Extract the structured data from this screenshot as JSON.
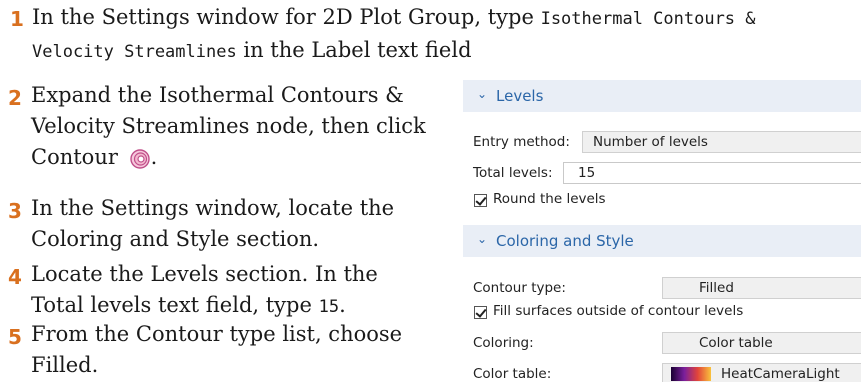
{
  "steps": [
    {
      "number": "1",
      "text_before": "In the Settings window for 2D Plot Group, type ",
      "code_1": "Isothermal Contours &",
      "code_2": "Velocity Streamlines",
      "text_after": " in the Label text field"
    },
    {
      "number": "2",
      "text_line1": "Expand the Isothermal Contours &",
      "text_line2": "Velocity Streamlines node, then click",
      "text_line3": "Contour",
      "icon": "contour-icon"
    },
    {
      "number": "3",
      "text_line1": "In the Settings window, locate the",
      "text_line2": "Coloring and Style section."
    },
    {
      "number": "4",
      "text_line1": "Locate the Levels section. In the",
      "text_line2_before": "Total levels text field, type ",
      "text_line2_code": "15",
      "text_line2_after": "."
    },
    {
      "number": "5",
      "text_line1": "From the Contour type list, choose",
      "text_line2": "Filled."
    }
  ],
  "settings": {
    "levels": {
      "title": "Levels",
      "entry_method_label": "Entry method:",
      "entry_method_value": "Number of levels",
      "total_levels_label": "Total levels:",
      "total_levels_value": "15",
      "round_levels_label": "Round the levels",
      "round_levels_checked": true
    },
    "coloring_style": {
      "title": "Coloring and Style",
      "contour_type_label": "Contour type:",
      "contour_type_value": "Filled",
      "fill_outside_label": "Fill surfaces outside of contour levels",
      "fill_outside_checked": true,
      "coloring_label": "Coloring:",
      "coloring_value": "Color table",
      "color_table_label": "Color table:",
      "color_table_value": "HeatCameraLight"
    }
  },
  "colors": {
    "step_number": "#d9701f",
    "section_header_bg": "#e9eef6",
    "section_header_text": "#2b66a8"
  }
}
